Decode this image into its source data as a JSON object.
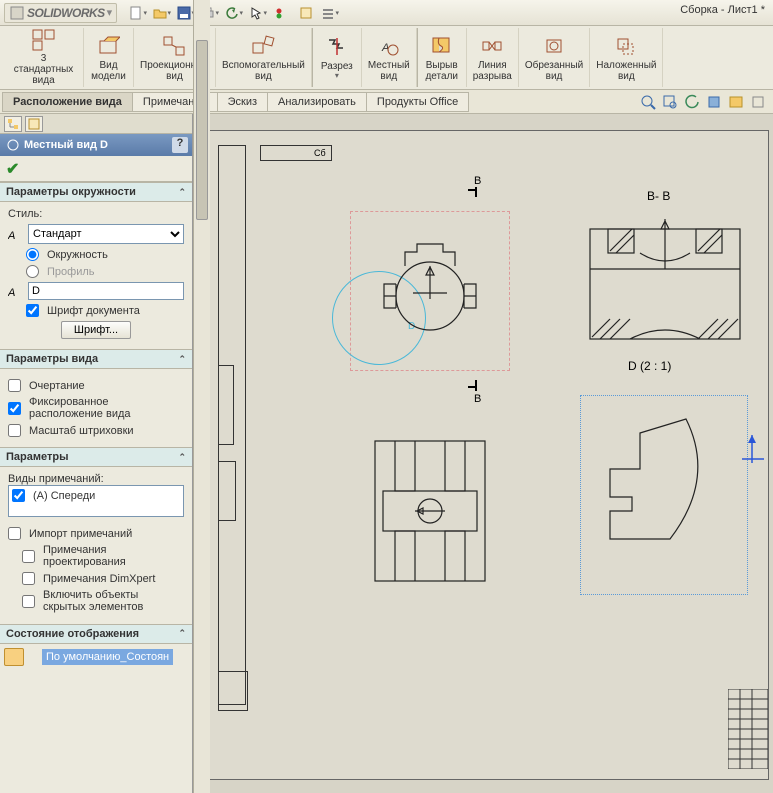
{
  "app": {
    "name": "SOLIDWORKS",
    "doc_title": "Сборка - Лист1 *"
  },
  "ribbon": [
    {
      "label": "3\nстандартных\nвида"
    },
    {
      "label": "Вид\nмодели"
    },
    {
      "label": "Проекционный\nвид"
    },
    {
      "label": "Вспомогательный\nвид"
    },
    {
      "label": "Разрез"
    },
    {
      "label": "Местный\nвид"
    },
    {
      "label": "Вырыв\nдетали"
    },
    {
      "label": "Линия\nразрыва"
    },
    {
      "label": "Обрезанный\nвид"
    },
    {
      "label": "Наложенный\nвид"
    }
  ],
  "tabs": [
    "Расположение вида",
    "Примечание",
    "Эскиз",
    "Анализировать",
    "Продукты Office"
  ],
  "feature": {
    "title": "Местный вид D"
  },
  "circle_params": {
    "header": "Параметры окружности",
    "style_label": "Стиль:",
    "style_value": "Стандарт",
    "radio_circle": "Окружность",
    "radio_profile": "Профиль",
    "name_value": "D",
    "doc_font": "Шрифт документа",
    "font_btn": "Шрифт..."
  },
  "view_params": {
    "header": "Параметры вида",
    "outline": "Очертание",
    "fixed_pos": "Фиксированное расположение вида",
    "hatch_scale": "Масштаб штриховки"
  },
  "params": {
    "header": "Параметры",
    "anno_types": "Виды примечаний:",
    "front": "(А) Спереди",
    "import_anno": "Импорт примечаний",
    "design_anno": "Примечания проектирования",
    "dimxpert": "Примечания DimXpert",
    "hidden_obj": "Включить объекты скрытых элементов"
  },
  "display_state": {
    "header": "Состояние отображения",
    "item": "По умолчанию_Состоян"
  },
  "drawing": {
    "section_b": "B",
    "section_bb": "B- B",
    "detail_label": "D  (2 : 1)",
    "sheet_rev": "Сб"
  }
}
